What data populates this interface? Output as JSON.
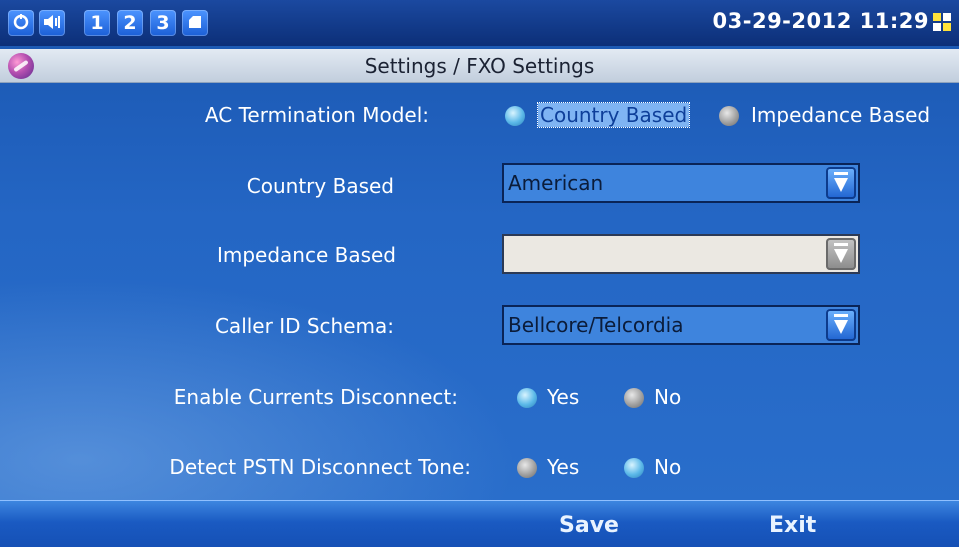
{
  "statusbar": {
    "icons": [
      {
        "name": "network-icon",
        "text": ""
      },
      {
        "name": "volume-icon",
        "text": ""
      },
      {
        "name": "line-1-icon",
        "text": "1"
      },
      {
        "name": "line-2-icon",
        "text": "2"
      },
      {
        "name": "line-3-icon",
        "text": "3"
      },
      {
        "name": "sd-card-icon",
        "text": ""
      }
    ],
    "datetime": "03-29-2012 11:29"
  },
  "title": "Settings / FXO Settings",
  "form": {
    "ac_termination": {
      "label": "AC Termination Model:",
      "options": [
        "Country Based",
        "Impedance Based"
      ],
      "selected": "Country Based"
    },
    "country_based": {
      "label": "Country Based",
      "value": "American"
    },
    "impedance_based": {
      "label": "Impedance Based",
      "value": ""
    },
    "caller_id": {
      "label": "Caller ID Schema:",
      "value": "Bellcore/Telcordia"
    },
    "currents_disconnect": {
      "label": "Enable Currents Disconnect:",
      "yes": "Yes",
      "no": "No",
      "selected": "Yes"
    },
    "pstn_tone": {
      "label": "Detect PSTN Disconnect Tone:",
      "yes": "Yes",
      "no": "No",
      "selected": "No"
    }
  },
  "softkeys": {
    "save": "Save",
    "exit": "Exit"
  },
  "colors": {
    "accent": "#2466c4",
    "radio_on": "#5ab8e8",
    "radio_off": "#9a9a9a"
  }
}
